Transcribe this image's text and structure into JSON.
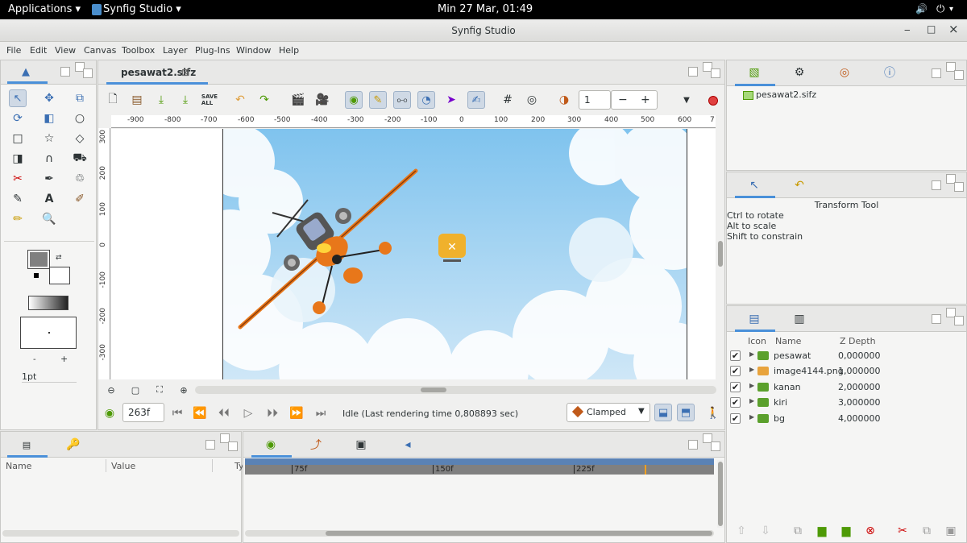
{
  "topbar": {
    "applications": "Applications ▾",
    "app": "Synfig Studio ▾",
    "clock": "Min 27 Mar, 01:49",
    "volume_icon": "volume-icon",
    "power_icon": "power-icon"
  },
  "window": {
    "title": "Synfig Studio",
    "min": "‒",
    "max": "□",
    "close": "×"
  },
  "menu": [
    "File",
    "Edit",
    "View",
    "Canvas",
    "Toolbox",
    "Layer",
    "Plug-Ins",
    "Window",
    "Help"
  ],
  "document_tab": {
    "label": "pesawat2.sifz",
    "close": "⊠"
  },
  "toolbar": {
    "frame_spin_value": "1",
    "minus": "−",
    "plus": "+"
  },
  "ruler_h": [
    "-900",
    "-800",
    "-700",
    "-600",
    "-500",
    "-400",
    "-300",
    "-200",
    "-100",
    "0",
    "100",
    "200",
    "300",
    "400",
    "500",
    "600",
    "7"
  ],
  "ruler_v": [
    "300",
    "200",
    "100",
    "0",
    "-100",
    "-200",
    "-300"
  ],
  "timebar": {
    "frame": "263f",
    "status": "Idle (Last rendering time 0,808893 sec)",
    "interpolation": "Clamped"
  },
  "toolbox": {
    "width_value": "1pt",
    "minus": "-",
    "plus": "+"
  },
  "params_panel": {
    "col_name": "Name",
    "col_value": "Value",
    "col_type": "Ty"
  },
  "timetrack": {
    "ticks": [
      "75f",
      "150f",
      "225f"
    ]
  },
  "canvas_browser": {
    "file": "pesawat2.sifz"
  },
  "tool_options": {
    "title": "Transform Tool",
    "lines": [
      "Ctrl to rotate",
      "Alt to scale",
      "Shift to constrain"
    ]
  },
  "layers_panel": {
    "col_icon": "Icon",
    "col_name": "Name",
    "col_z": "Z Depth",
    "layers": [
      {
        "name": "pesawat",
        "z": "0,000000",
        "color": "#4e9a06"
      },
      {
        "name": "image4144.png",
        "z": "1,000000",
        "color": "#e8a33c"
      },
      {
        "name": "kanan",
        "z": "2,000000",
        "color": "#4e9a06"
      },
      {
        "name": "kiri",
        "z": "3,000000",
        "color": "#4e9a06"
      },
      {
        "name": "bg",
        "z": "4,000000",
        "color": "#4e9a06"
      }
    ]
  },
  "colors": {
    "accent": "#4a90d9",
    "sky_top": "#7fc3ee",
    "sky_bottom": "#d7ecf8",
    "plane_orange": "#e8771a"
  }
}
